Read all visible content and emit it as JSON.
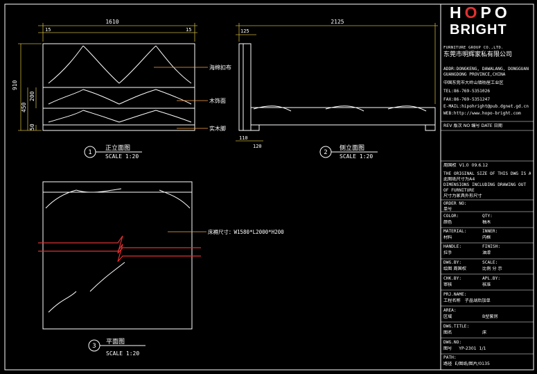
{
  "views": {
    "front": {
      "number": "1",
      "title": "正立面图",
      "scale": "SCALE 1:20"
    },
    "side": {
      "number": "2",
      "title": "侧立面图",
      "scale": "SCALE 1:20"
    },
    "plan": {
      "number": "3",
      "title": "平面图",
      "scale": "SCALE 1:20"
    }
  },
  "dimensions": {
    "front_width": "1610",
    "front_left_inset": "15",
    "front_right_inset": "15",
    "height_total": "910",
    "height_450": "450",
    "height_200": "200",
    "height_50": "50",
    "side_width": "2125",
    "side_125": "125",
    "side_110": "110",
    "side_120": "120"
  },
  "annotations": {
    "fabric": "海绵扣布",
    "wood_face": "木饰面",
    "solid_wood_foot": "实木脚",
    "bed_size": "床褥尺寸：W1580*L2000*H200"
  },
  "title_block": {
    "logo_word1_a": "H",
    "logo_word1_b": "O",
    "logo_word1_c": "PO",
    "logo_word2": "BRIGHT",
    "company_en": "FURNITURE GROUP CO.,LTD.",
    "company_cn": "东莞市明辉家私有限公司",
    "addr_en1": "ADDR:DONGKENG, DAWALANG, DONGGUAN",
    "addr_en2": "GUANGDONG PROVINCE,CHINA",
    "addr_cn": "中国东莞市大岭山镇杨屋工业区",
    "tel": "TEL:86-769-5351026",
    "fax": "FAX:86-769-5351247",
    "email": "E-MAIL:hipohright@pub.dgnet.gd.cn",
    "web": "WEB:http://www.hopo-bright.com",
    "rev_header": "REV 版次   NO 编号   DATE 日期",
    "drawn_by": "周国权",
    "version": "V1.0",
    "date": "09.6.12",
    "note_en1": "THE ORIGINAL SIZE OF THIS DWG IS A4",
    "note_cn1": "此图纸尺寸为A4",
    "note_en2": "DIMENSIONS INCLUDING DRAWING OUT",
    "note_en3": "OF FURNITURE",
    "note_cn2": "尺寸为家具外形尺寸",
    "order_no_label": "ORDER NO:",
    "order_no_cn": "单号",
    "color_label": "COLOR:",
    "color_cn": "颜色",
    "color_value": "柚木",
    "qty_label": "QTY:",
    "qty_cn": "数量",
    "material_label": "MATERIAL:",
    "material_cn": "材料",
    "material_value": "榉木",
    "inner_label": "INNER:",
    "inner_cn": "内框",
    "handle_label": "HANDLE:",
    "handle_cn": "拉手",
    "finish_label": "FINISH:",
    "finish_cn": "油漆",
    "dwg_by_label": "DWG.BY:",
    "dwg_by_value": "绘图  周国权",
    "scale_label": "SCALE:",
    "scale_value": "比例  分  示",
    "chk_by_label": "CHK.BY:",
    "chk_by_cn": "审核",
    "apl_by_label": "APL.BY:",
    "apl_by_cn": "核准",
    "prj_name_label": "PRJ.NAME:",
    "prj_name_cn": "工程名称",
    "prj_name_value": "子晶湖后加单",
    "area_label": "AREA:",
    "area_cn": "区域",
    "area_value": "B型套房",
    "dwg_title_label": "DWG.TITLE:",
    "dwg_title_cn": "图名",
    "dwg_title_value": "床",
    "dwg_no_label": "DWG.NO:",
    "dwg_no_cn": "图号",
    "dwg_no_value": "YP-2301",
    "sheet": "1/1",
    "path_label": "PATH:",
    "path_cn": "路径",
    "path_value": "E/图纸/图片/0135"
  },
  "colors": {
    "background": "#000000",
    "line": "#ffffff",
    "dimension": "#c7b23a",
    "leader": "#ffa94d",
    "centerline": "#e03131",
    "logo_accent": "#e03131"
  }
}
